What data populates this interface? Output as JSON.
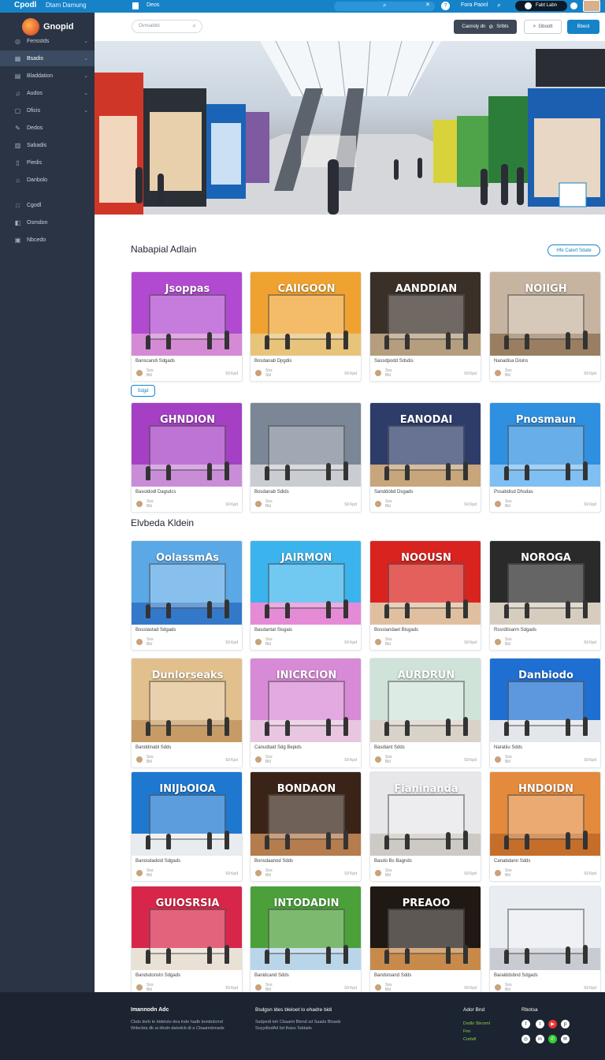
{
  "topbar": {
    "brand": "Cpodl",
    "title": "Dtam Damung",
    "tab": "Deos",
    "user_label": "Fora Paonl",
    "badge_label": "Fabt Labn"
  },
  "sidebar": {
    "logo_text": "Gnopid",
    "items": [
      {
        "label": "Fensstds",
        "icon": "explore-icon"
      },
      {
        "label": "Bsadis",
        "icon": "store-icon"
      },
      {
        "label": "Bladdation",
        "icon": "grid-icon"
      },
      {
        "label": "Audos",
        "icon": "audio-icon"
      },
      {
        "label": "Dficis",
        "icon": "files-icon"
      },
      {
        "label": "Dedos",
        "icon": "edit-icon"
      },
      {
        "label": "Sabadis",
        "icon": "chart-icon"
      },
      {
        "label": "Piedis",
        "icon": "doc-icon"
      },
      {
        "label": "Danbolo",
        "icon": "home-icon"
      },
      {
        "label": "Cgodl",
        "icon": "box-icon"
      },
      {
        "label": "Osmdon",
        "icon": "bag-icon"
      },
      {
        "label": "Nbcedo",
        "icon": "cart-icon"
      }
    ]
  },
  "main": {
    "search_placeholder": "Ovnsaldoi",
    "btn_create": "Caonsly dn",
    "btn_secondary": "Srlbts",
    "btn_tertiary": "Gboott",
    "btn_primary": "Bbeot",
    "section1_title": "Nabapial Adlain",
    "section1_link": "Hfe Calert Sdate",
    "filter_chip": "Sdgd",
    "section2_title": "Elvbeda Kldein"
  },
  "cards": [
    {
      "sign": "Jsoppas",
      "caption": "Banscandi Sdgads",
      "meta": "Sos\nBkl",
      "time": "Sll Kpd",
      "bg": "#b14ad0",
      "floor": "#d58ad6"
    },
    {
      "sign": "CAIIGOON",
      "caption": "Bosdanab Dpgdis",
      "meta": "Sos\nSbl",
      "time": "Sll Kpd",
      "bg": "#f0a230",
      "floor": "#e8c47b"
    },
    {
      "sign": "AANDDIAN",
      "caption": "Sassdpodd Sdsdis",
      "meta": "Sos\nBkl",
      "time": "Sll Kpd",
      "bg": "#3a3028",
      "floor": "#b59e7d"
    },
    {
      "sign": "NOIIGH",
      "caption": "Nanadisa Disins",
      "meta": "Sos\nBkl",
      "time": "Sll Kpd",
      "bg": "#c7b4a0",
      "floor": "#9a7e62"
    },
    {
      "sign": "GHNDION",
      "caption": "Basoidodl Dagsdcs",
      "meta": "Sos\nBkl",
      "time": "Sll Kpd",
      "bg": "#a53fc4",
      "floor": "#c98dd8"
    },
    {
      "sign": "",
      "caption": "Bosdanab Sdids",
      "meta": "Sos\nBkl",
      "time": "Sll Kpd",
      "bg": "#7b8796",
      "floor": "#c9ccd1"
    },
    {
      "sign": "EANODAI",
      "caption": "Sanddobd Dsgads",
      "meta": "Sos\nBkl",
      "time": "Sll Kpd",
      "bg": "#2e3c6a",
      "floor": "#c7a67c"
    },
    {
      "sign": "Pnosmaun",
      "caption": "Pssabdisd Dhsdas",
      "meta": "Sos\nBkl",
      "time": "Sll Kpd",
      "bg": "#2f8fe0",
      "floor": "#7fbff2"
    },
    {
      "sign": "OolassmAs",
      "caption": "Bosslastad Sdgads",
      "meta": "Sos\nBkl",
      "time": "Sll Kpd",
      "bg": "#5aa8e6",
      "floor": "#3479c9"
    },
    {
      "sign": "JAIRMON",
      "caption": "Basdantat Sisgais",
      "meta": "Sos\nBkl",
      "time": "Sll Kpd",
      "bg": "#3bb3ec",
      "floor": "#e58bd6"
    },
    {
      "sign": "NOOUSN",
      "caption": "Bosslandaet Bisgads",
      "meta": "Sos\nBkl",
      "time": "Sll Kpd",
      "bg": "#d8231f",
      "floor": "#e0bfa0"
    },
    {
      "sign": "NOROGA",
      "caption": "Rssrdtisarm Sdgads",
      "meta": "Sos\nBkl",
      "time": "Sll Kpd",
      "bg": "#2a2a2a",
      "floor": "#d7cdbf"
    },
    {
      "sign": "Dunlorseaks",
      "caption": "Banddinabl Sdds",
      "meta": "Sos\nBkl",
      "time": "Sll Kpd",
      "bg": "#e2c08e",
      "floor": "#c79b66"
    },
    {
      "sign": "INICRCION",
      "caption": "Canudtaid Sdg Bepids",
      "meta": "Sos\nBkl",
      "time": "Sll Kpd",
      "bg": "#d78ad5",
      "floor": "#e8c6e0"
    },
    {
      "sign": "AURDRUN",
      "caption": "Basdiant Sdds",
      "meta": "Sos\nBkl",
      "time": "Sll Kpd",
      "bg": "#cfe3d9",
      "floor": "#d8d2c8"
    },
    {
      "sign": "Danbiodo",
      "caption": "Naratiiu Sdds",
      "meta": "Sos\nBkl",
      "time": "Sll Kpd",
      "bg": "#1f6fd2",
      "floor": "#e3e6ea"
    },
    {
      "sign": "INIJbOIOA",
      "caption": "Banosdadoid Sdgads",
      "meta": "Sos\nBkl",
      "time": "Sll Kpd",
      "bg": "#1e78d0",
      "floor": "#e9ecef"
    },
    {
      "sign": "BONDAON",
      "caption": "Bonsdaanod Sdds",
      "meta": "Sos\nBkl",
      "time": "Sll Kpd",
      "bg": "#3a2418",
      "floor": "#b57c4d"
    },
    {
      "sign": "Fianinanda",
      "caption": "Basdo Bs Bagnds",
      "meta": "Sos\nBkl",
      "time": "Sll Kpd",
      "bg": "#e7e7ea",
      "floor": "#cdc9c4"
    },
    {
      "sign": "HNDOIDN",
      "caption": "Canabdann Sdds",
      "meta": "Sos\nBkl",
      "time": "Sll Kpd",
      "bg": "#e38a3c",
      "floor": "#c46e2a"
    },
    {
      "sign": "GUIOSRSIA",
      "caption": "Bandsdonstn Sdgads",
      "meta": "Sos\nBkl",
      "time": "Sll Kpd",
      "bg": "#d8264a",
      "floor": "#e9e1d6"
    },
    {
      "sign": "INTODADIN",
      "caption": "Banidcand Sdds",
      "meta": "Sos\nBkl",
      "time": "Sll Kpd",
      "bg": "#4ba03a",
      "floor": "#b9d5ea"
    },
    {
      "sign": "PREAOO",
      "caption": "Bandstoand Sdds",
      "meta": "Sos\nBkl",
      "time": "Sll Kpd",
      "bg": "#201812",
      "floor": "#c78a4a"
    },
    {
      "sign": "",
      "caption": "Baralddsbnd Sdgads",
      "meta": "Sos\nBkl",
      "time": "Sll Kpd",
      "bg": "#e9ecf0",
      "floor": "#c8ccd2"
    }
  ],
  "footer": {
    "col1_title": "Imannodn Adc",
    "col1_text": "Cbds tiorb te bidelsto dea lnde hadb bombdcmd\nWdecbia db ai dlodn datsdcb dt a Cbaamdonads",
    "col2_title": "Bsdgsn ldes bleloet lo ehadre bidi",
    "col2_text": "Ssdpedt teh Cbaamt Blend sd Saads Bloads\nSoyydtsdAd bd thass Sddads",
    "col3_title": "Ador Bnd",
    "col3_links": [
      "Dsdlo Sbcoml",
      "Fno",
      "Corbdl"
    ],
    "col4_title": "Rbotsa"
  },
  "colors": {
    "accent": "#1683c9",
    "sidebar": "#2b3444",
    "footer": "#1b2430",
    "link_green": "#8ed04a"
  }
}
